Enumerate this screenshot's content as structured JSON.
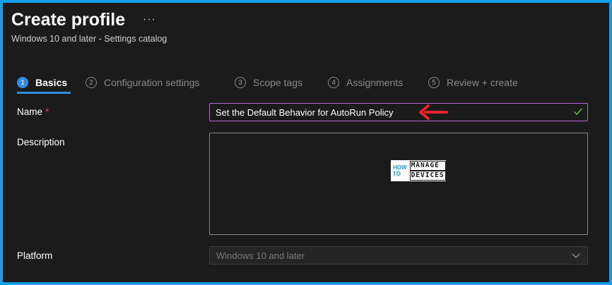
{
  "header": {
    "title": "Create profile",
    "more_label": "···",
    "subtitle": "Windows 10 and later - Settings catalog"
  },
  "tabs": [
    {
      "step": "1",
      "label": "Basics",
      "active": true
    },
    {
      "step": "2",
      "label": "Configuration settings",
      "active": false
    },
    {
      "step": "3",
      "label": "Scope tags",
      "active": false
    },
    {
      "step": "4",
      "label": "Assignments",
      "active": false
    },
    {
      "step": "5",
      "label": "Review + create",
      "active": false
    }
  ],
  "form": {
    "name_label": "Name",
    "required_mark": "*",
    "name_value": "Set the Default Behavior for AutoRun Policy",
    "description_label": "Description",
    "description_value": "",
    "platform_label": "Platform",
    "platform_value": "Windows 10 and later"
  },
  "watermark": {
    "how": "HOW",
    "to": "TO",
    "manage": "MANAGE",
    "devices": "DEVICES"
  },
  "colors": {
    "accent": "#2f8ee0",
    "focus_border": "#b768d8",
    "check": "#6cc24a",
    "arrow": "#e8242a",
    "frame": "#14a0e6"
  },
  "icons": {
    "more": "more-icon",
    "check": "check-icon",
    "chevron": "chevron-down-icon",
    "arrow": "red-arrow-annotation"
  }
}
